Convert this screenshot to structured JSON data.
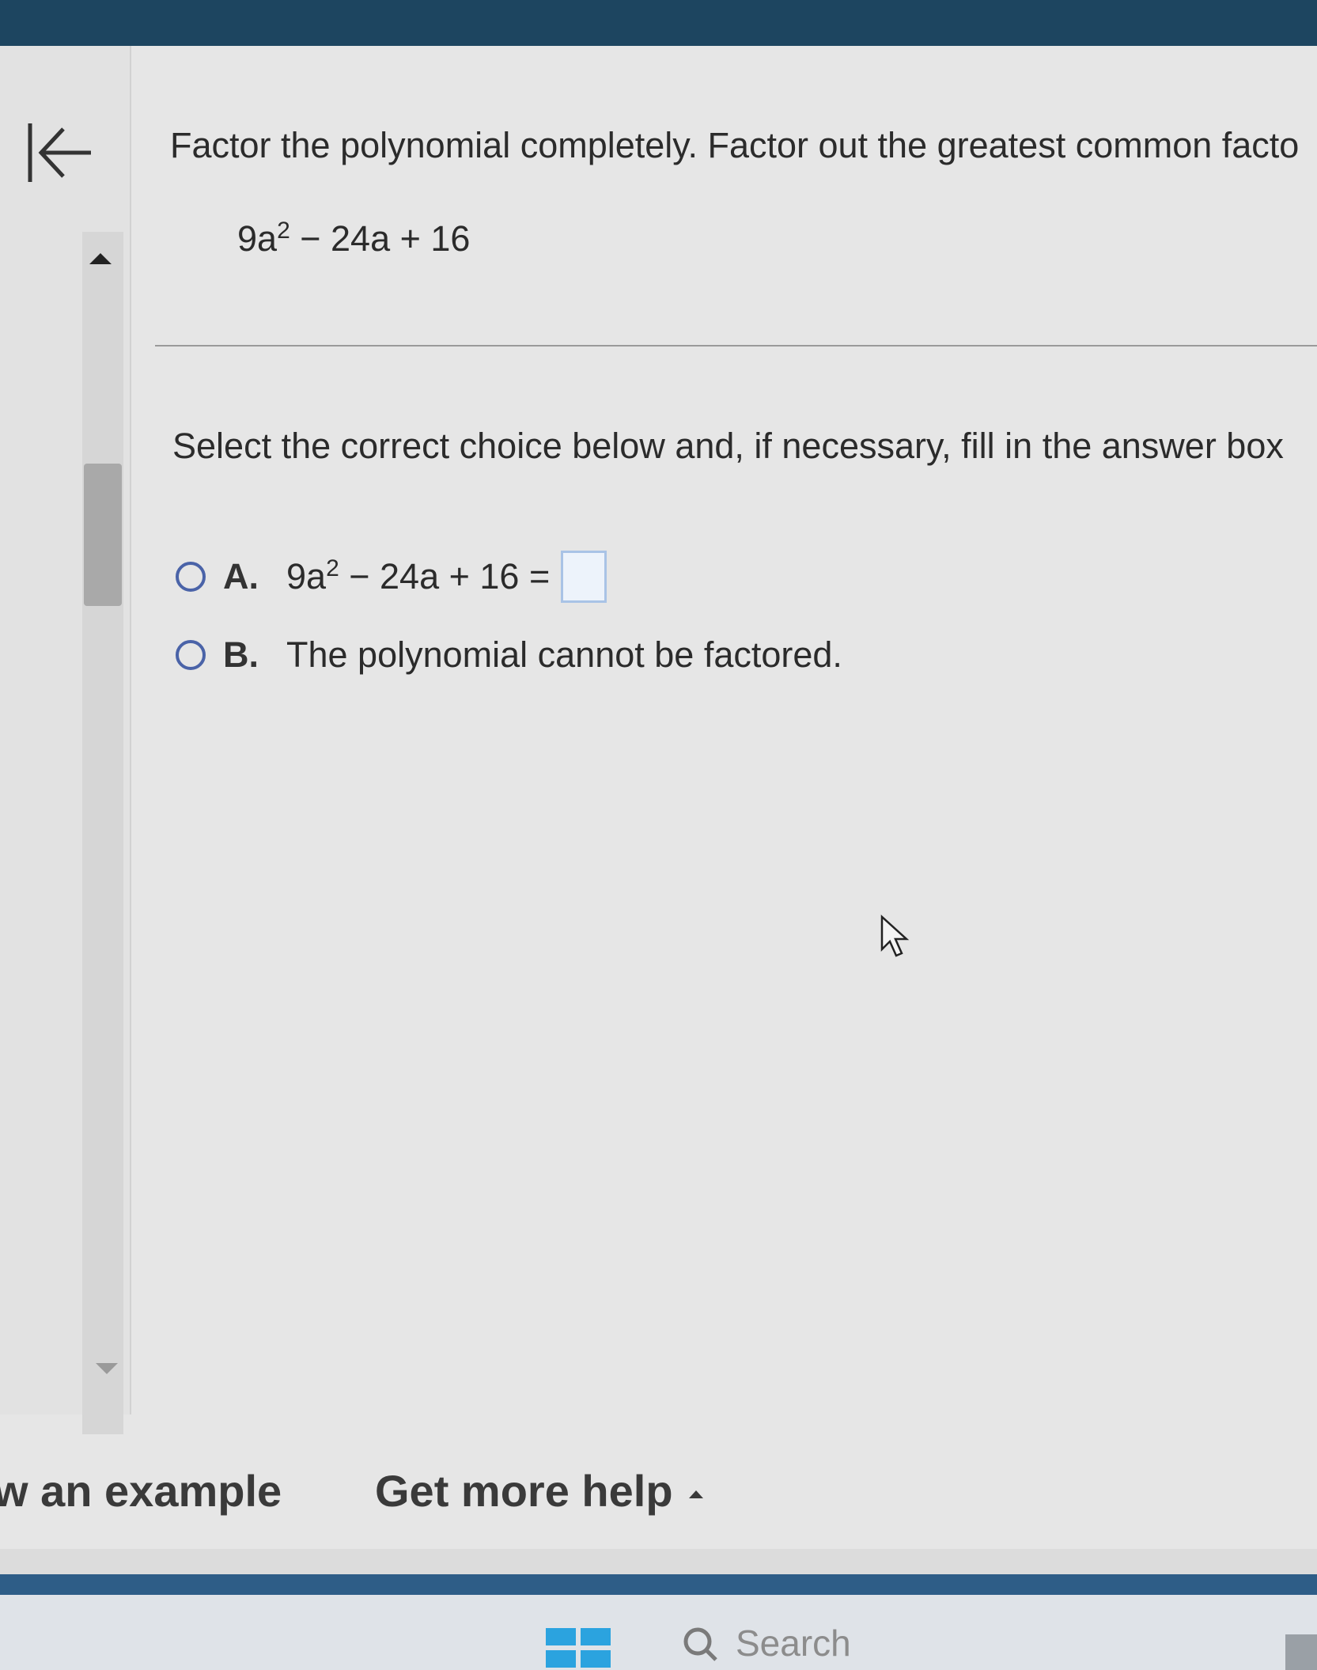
{
  "question": {
    "prompt": "Factor the polynomial completely. Factor out the greatest common facto",
    "expression": {
      "part1": "9a",
      "exp": "2",
      "part2": " − 24a + 16"
    }
  },
  "instruction": "Select the correct choice below and, if necessary, fill in the answer box",
  "choices": [
    {
      "letter": "A.",
      "expr_part1": "9a",
      "expr_exp": "2",
      "expr_part2": " − 24a + 16 ="
    },
    {
      "letter": "B.",
      "text": "The polynomial cannot be factored."
    }
  ],
  "footer": {
    "example": "w an example",
    "help": "Get more help"
  },
  "taskbar": {
    "search_label": "Search"
  },
  "colors": {
    "topbar": "#1d4560",
    "radio": "#4a63a8",
    "answer_box_border": "#a9c3e6"
  }
}
